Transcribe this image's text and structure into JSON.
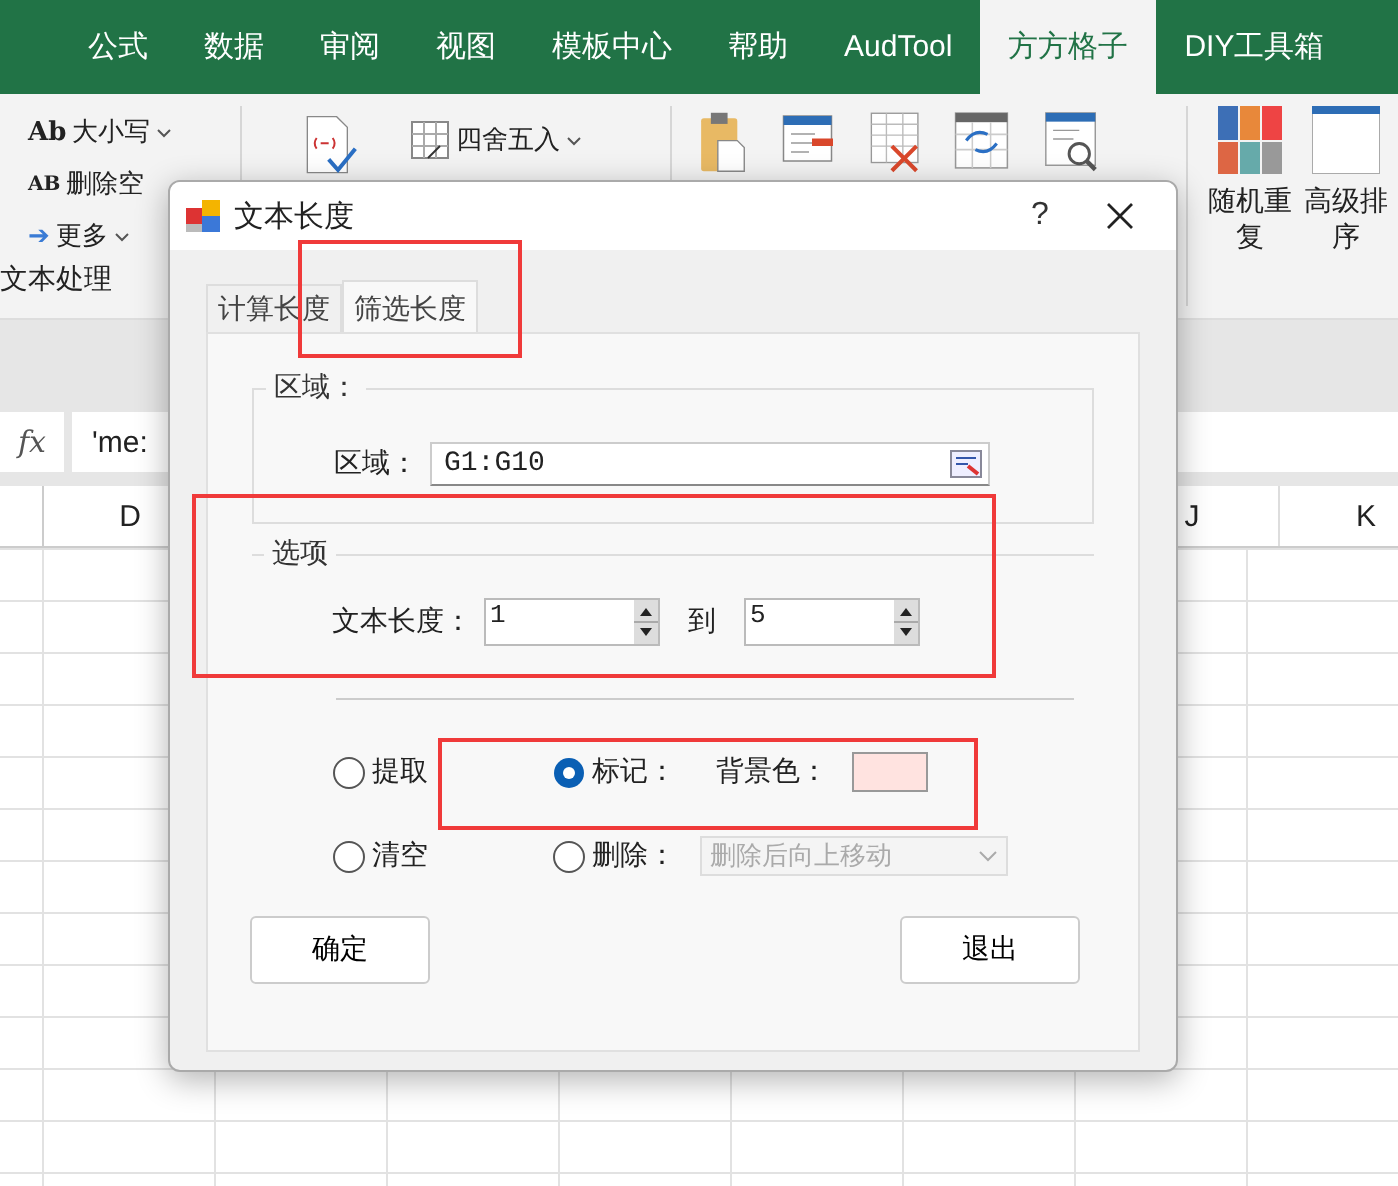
{
  "ribbon_tabs": [
    {
      "label": "公式",
      "selected": false
    },
    {
      "label": "数据",
      "selected": false
    },
    {
      "label": "审阅",
      "selected": false
    },
    {
      "label": "视图",
      "selected": false
    },
    {
      "label": "模板中心",
      "selected": false
    },
    {
      "label": "帮助",
      "selected": false
    },
    {
      "label": "AudTool",
      "selected": false
    },
    {
      "label": "方方格子",
      "selected": true
    },
    {
      "label": "DIY工具箱",
      "selected": false
    }
  ],
  "ribbon": {
    "text_group": {
      "items": [
        {
          "badge": "Ab",
          "label": "大小写"
        },
        {
          "badge": "AB",
          "label": "删除空"
        },
        {
          "badge": "➔",
          "label": "更多"
        }
      ],
      "title": "文本处理"
    },
    "number_group": {
      "label": "四舍五入"
    },
    "sort_group": {
      "items": [
        {
          "label": "随机重复"
        },
        {
          "label": "高级排序"
        }
      ]
    }
  },
  "formula_bar": {
    "fx": "fx",
    "content": "'me:"
  },
  "columns": [
    "D",
    "J",
    "K"
  ],
  "dialog": {
    "title": "文本长度",
    "help": "?",
    "tabs": [
      {
        "label": "计算长度",
        "selected": false
      },
      {
        "label": "筛选长度",
        "selected": true
      }
    ],
    "range_group": {
      "title": "区域：",
      "label": "区域：",
      "value": "G1:G10"
    },
    "options_group": {
      "title": "选项",
      "label": "文本长度：",
      "from": "1",
      "to_label": "到",
      "to": "5"
    },
    "actions": [
      {
        "kind": "plain",
        "label": "提取",
        "selected": false
      },
      {
        "kind": "color",
        "label": "标记：",
        "selected": true,
        "color_label": "背景色：",
        "color": "#ffe3e0"
      },
      {
        "kind": "plain",
        "label": "清空",
        "selected": false
      },
      {
        "kind": "select",
        "label": "删除：",
        "selected": false,
        "select_value": "删除后向上移动",
        "disabled": true
      }
    ],
    "buttons": [
      "确定",
      "退出"
    ]
  }
}
